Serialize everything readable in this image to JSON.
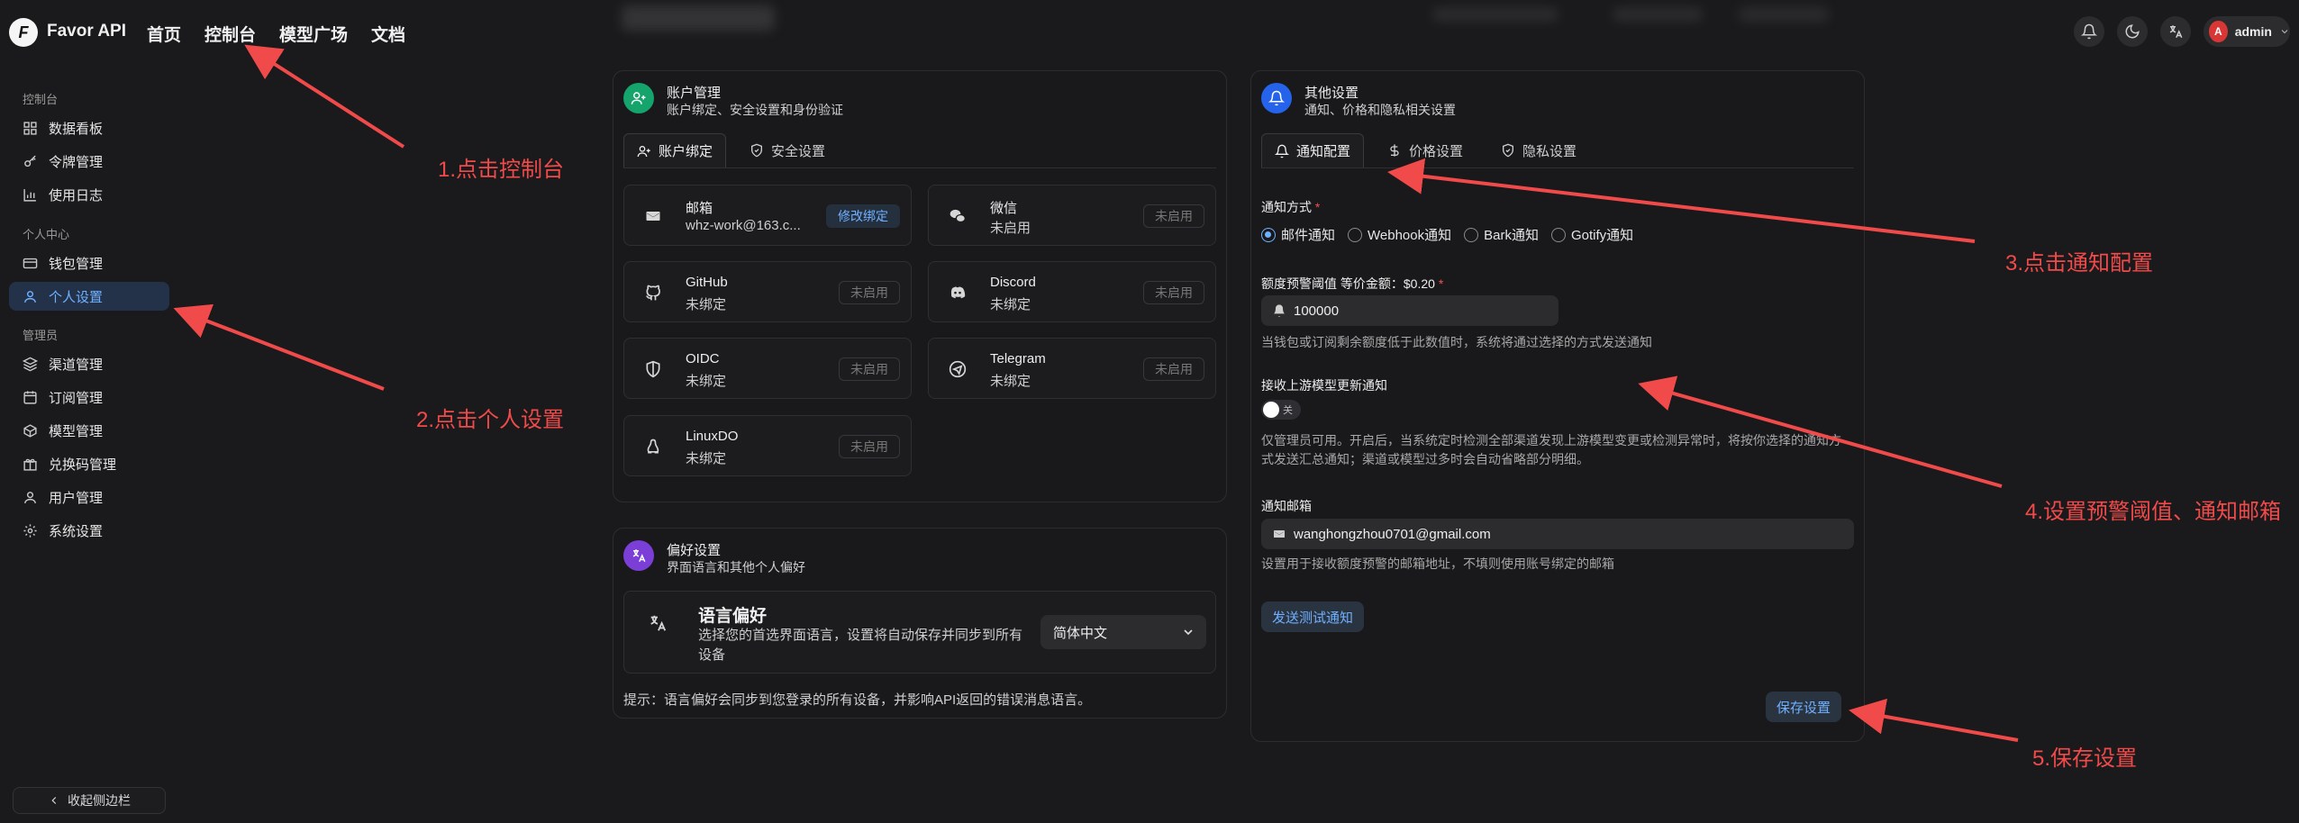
{
  "header": {
    "logo_letter": "F",
    "brand": "Favor API",
    "nav": [
      "首页",
      "控制台",
      "模型广场",
      "文档"
    ],
    "user": {
      "avatar_letter": "A",
      "name": "admin"
    }
  },
  "sidebar": {
    "sections": [
      {
        "title": "控制台",
        "items": [
          "数据看板",
          "令牌管理",
          "使用日志"
        ]
      },
      {
        "title": "个人中心",
        "items": [
          "钱包管理",
          "个人设置"
        ]
      },
      {
        "title": "管理员",
        "items": [
          "渠道管理",
          "订阅管理",
          "模型管理",
          "兑换码管理",
          "用户管理",
          "系统设置"
        ]
      }
    ],
    "active_item": "个人设置",
    "collapse_label": "收起侧边栏"
  },
  "account": {
    "title": "账户管理",
    "subtitle": "账户绑定、安全设置和身份验证",
    "tabs": [
      "账户绑定",
      "安全设置"
    ],
    "bindings": [
      {
        "name": "邮箱",
        "value": "whz-work@163.c...",
        "button": "修改绑定",
        "icon": "mail-icon"
      },
      {
        "name": "微信",
        "value": "未启用",
        "button": "未启用",
        "icon": "wechat-icon"
      },
      {
        "name": "GitHub",
        "value": "未绑定",
        "button": "未启用",
        "icon": "github-icon"
      },
      {
        "name": "Discord",
        "value": "未绑定",
        "button": "未启用",
        "icon": "discord-icon"
      },
      {
        "name": "OIDC",
        "value": "未绑定",
        "button": "未启用",
        "icon": "shield-icon"
      },
      {
        "name": "Telegram",
        "value": "未绑定",
        "button": "未启用",
        "icon": "telegram-icon"
      },
      {
        "name": "LinuxDO",
        "value": "未绑定",
        "button": "未启用",
        "icon": "linux-icon"
      }
    ]
  },
  "preference": {
    "title": "偏好设置",
    "subtitle": "界面语言和其他个人偏好",
    "lang_title": "语言偏好",
    "lang_desc": "选择您的首选界面语言，设置将自动保存并同步到所有设备",
    "lang_value": "简体中文",
    "hint": "提示：语言偏好会同步到您登录的所有设备，并影响API返回的错误消息语言。"
  },
  "other": {
    "title": "其他设置",
    "subtitle": "通知、价格和隐私相关设置",
    "tabs": [
      "通知配置",
      "价格设置",
      "隐私设置"
    ],
    "notify_method_label": "通知方式",
    "methods": [
      "邮件通知",
      "Webhook通知",
      "Bark通知",
      "Gotify通知"
    ],
    "selected_method": "邮件通知",
    "threshold_label": "额度预警阈值 等价金额：$0.20",
    "threshold_value": "100000",
    "threshold_help": "当钱包或订阅剩余额度低于此数值时，系统将通过选择的方式发送通知",
    "upstream_label": "接收上游模型更新通知",
    "upstream_toggle": "关",
    "upstream_help": "仅管理员可用。开启后，当系统定时检测全部渠道发现上游模型变更或检测异常时，将按你选择的通知方式发送汇总通知；渠道或模型过多时会自动省略部分明细。",
    "email_label": "通知邮箱",
    "email_value": "wanghongzhou0701@gmail.com",
    "email_help": "设置用于接收额度预警的邮箱地址，不填则使用账号绑定的邮箱",
    "test_button": "发送测试通知",
    "save_button": "保存设置"
  },
  "annotations": [
    "1.点击控制台",
    "2.点击个人设置",
    "3.点击通知配置",
    "4.设置预警阈值、通知邮箱",
    "5.保存设置"
  ],
  "colors": {
    "accent": "#6fb0ff",
    "annotation": "#f04a4a",
    "background": "#1a1a1c"
  }
}
